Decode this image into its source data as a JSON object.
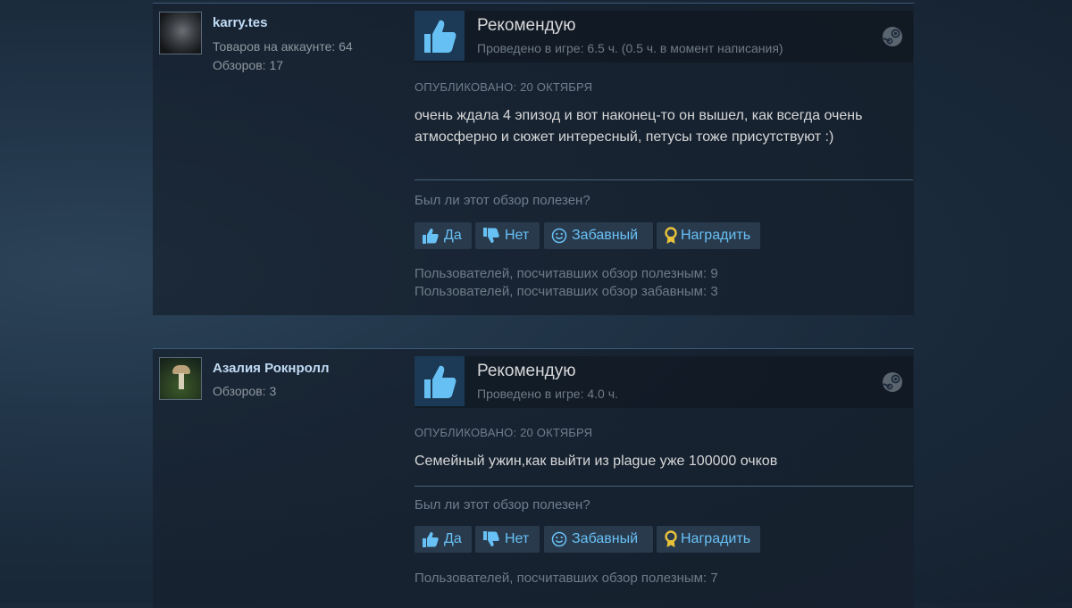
{
  "colors": {
    "accent": "#67c1f5",
    "thumb_bg": "#1c3a56",
    "award": "#e8c23a"
  },
  "reviews": [
    {
      "author": {
        "name": "karry.tes",
        "products": "Товаров на аккаунте: 64",
        "reviews": "Обзоров: 17",
        "avatar_icon": "avatar-dark-portrait"
      },
      "vote": {
        "icon": "thumbs-up-icon",
        "title": "Рекомендую",
        "hours": "Проведено в игре: 6.5 ч. (0.5 ч. в момент написания)"
      },
      "posted": "ОПУБЛИКОВАНО: 20 ОКТЯБРЯ",
      "text": "очень ждала 4 эпизод и вот наконец-то он вышел, как всегда очень атмосферно и сюжет интересный, петусы тоже присутствуют :)",
      "helpful_question": "Был ли этот обзор полезен?",
      "buttons": {
        "yes": "Да",
        "no": "Нет",
        "funny": "Забавный",
        "award": "Наградить"
      },
      "counts": [
        "Пользователей, посчитавших обзор полезным: 9",
        "Пользователей, посчитавших обзор забавным: 3"
      ]
    },
    {
      "author": {
        "name": "Азалия Рокнролл",
        "products": "",
        "reviews": "Обзоров: 3",
        "avatar_icon": "avatar-mushroom"
      },
      "vote": {
        "icon": "thumbs-up-icon",
        "title": "Рекомендую",
        "hours": "Проведено в игре: 4.0 ч."
      },
      "posted": "ОПУБЛИКОВАНО: 20 ОКТЯБРЯ",
      "text": "Семейный ужин,как выйти из plague уже 100000 очков",
      "helpful_question": "Был ли этот обзор полезен?",
      "buttons": {
        "yes": "Да",
        "no": "Нет",
        "funny": "Забавный",
        "award": "Наградить"
      },
      "counts": [
        "Пользователей, посчитавших обзор полезным: 7"
      ]
    }
  ]
}
